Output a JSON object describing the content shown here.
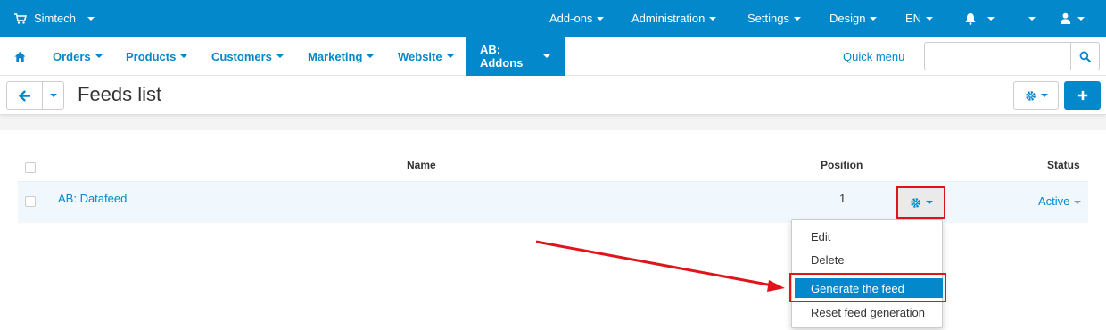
{
  "topbar": {
    "store": "Simtech",
    "items": [
      "Add-ons",
      "Administration",
      "Settings",
      "Design",
      "EN"
    ]
  },
  "mainnav": {
    "items": [
      "Orders",
      "Products",
      "Customers",
      "Marketing",
      "Website"
    ],
    "active": "AB: Addons",
    "quick_menu": "Quick menu",
    "search_value": "",
    "search_placeholder": ""
  },
  "page": {
    "title": "Feeds list"
  },
  "table": {
    "headers": {
      "name": "Name",
      "position": "Position",
      "status": "Status"
    },
    "rows": [
      {
        "name": "AB: Datafeed",
        "position": "1",
        "status": "Active"
      }
    ]
  },
  "dropdown": {
    "items": [
      "Edit",
      "Delete",
      "Generate the feed",
      "Reset feed generation"
    ]
  },
  "colors": {
    "accent": "#0388cc",
    "annotation": "#e0151b"
  }
}
